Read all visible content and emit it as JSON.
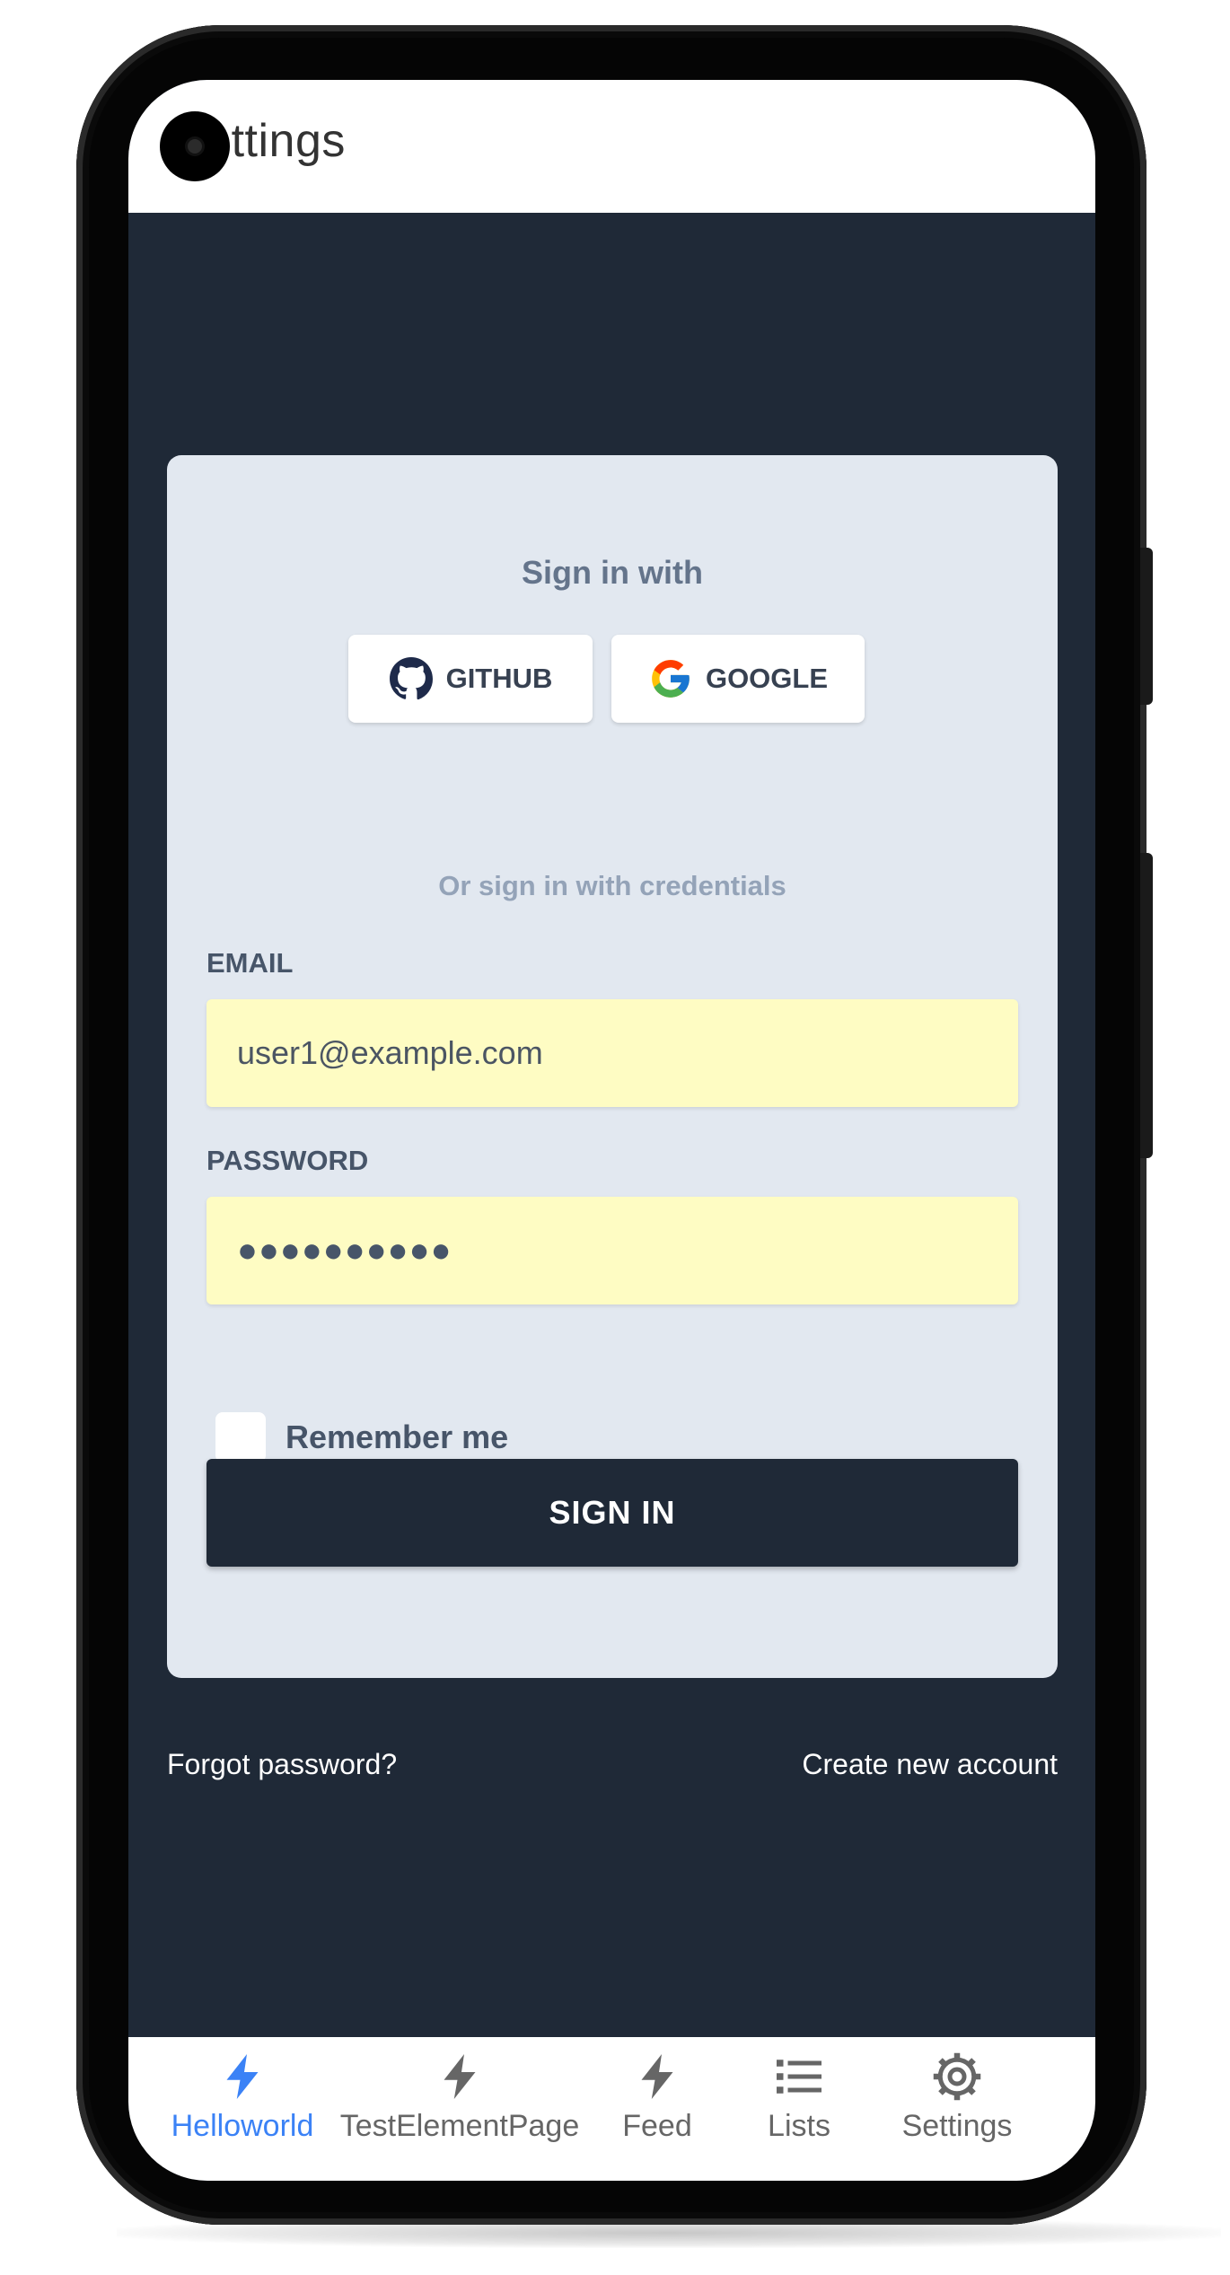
{
  "app_bar": {
    "title": "Settings"
  },
  "card": {
    "heading": "Sign in with",
    "social": {
      "github_label": "GITHUB",
      "google_label": "GOOGLE"
    },
    "divider_text": "Or sign in with credentials",
    "email": {
      "label": "EMAIL",
      "value": "user1@example.com"
    },
    "password": {
      "label": "PASSWORD",
      "value": "●●●●●●●●●●"
    },
    "remember_label": "Remember me",
    "remember_checked": false,
    "submit_label": "SIGN IN"
  },
  "links": {
    "forgot": "Forgot password?",
    "create": "Create new account"
  },
  "bottom_nav": {
    "items": [
      {
        "label": "Helloworld",
        "icon": "bolt-icon",
        "active": true
      },
      {
        "label": "TestElementPage",
        "icon": "bolt-icon",
        "active": false
      },
      {
        "label": "Feed",
        "icon": "bolt-icon",
        "active": false
      },
      {
        "label": "Lists",
        "icon": "list-icon",
        "active": false
      },
      {
        "label": "Settings",
        "icon": "gear-icon",
        "active": false
      }
    ]
  },
  "colors": {
    "page_background": "#1f2937",
    "card_background": "#e2e8f0",
    "input_autofill": "#fefcc3",
    "active_accent": "#3b82f6",
    "inactive_nav": "#666666"
  }
}
